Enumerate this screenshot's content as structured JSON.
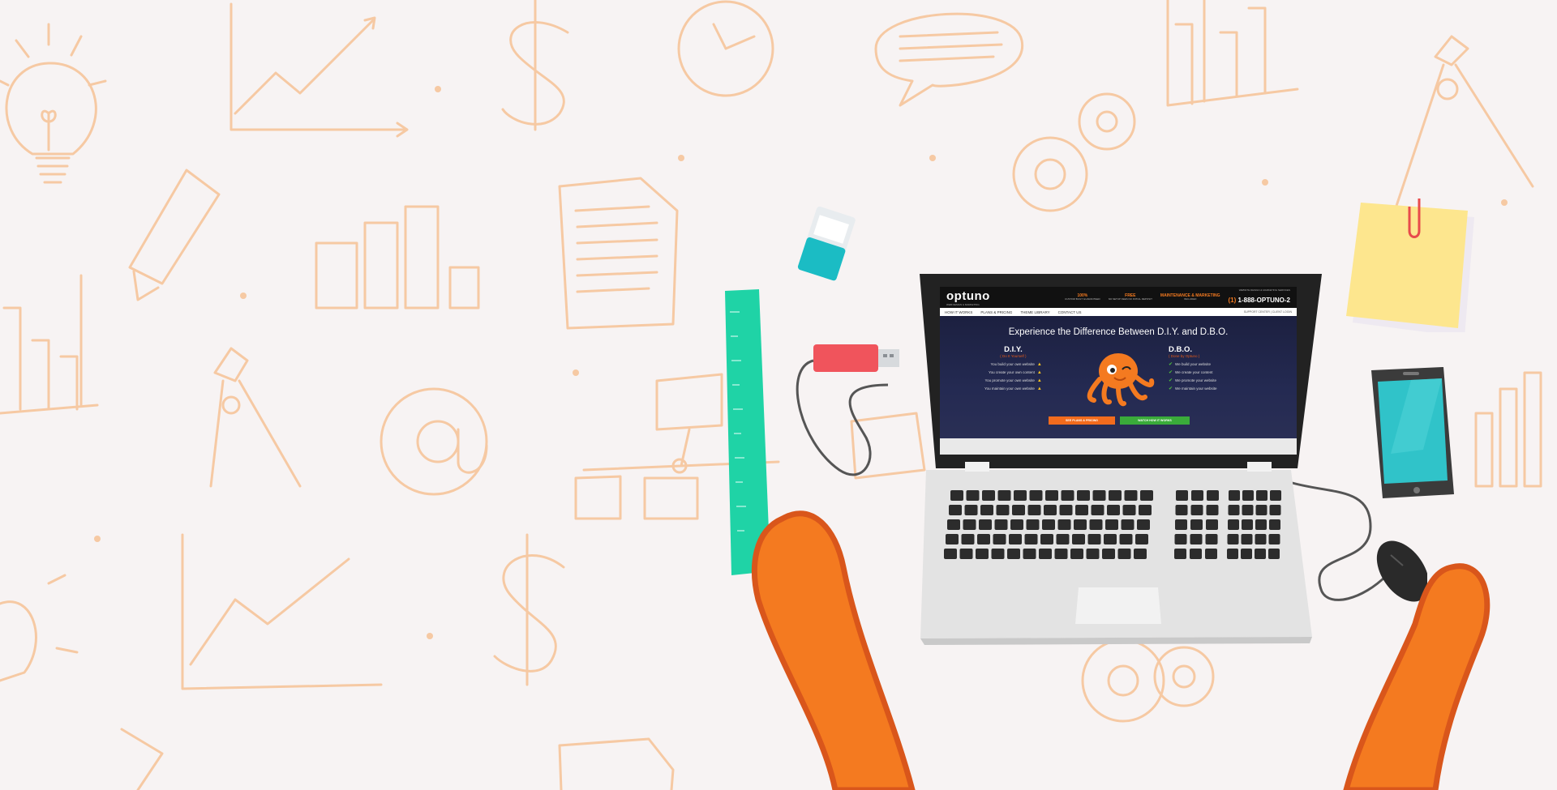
{
  "site": {
    "logo_text": "optuno",
    "logo_tagline": "WEB DESIGN & MARKETING",
    "badges": [
      {
        "title": "100%",
        "sub": "CUSTOM BUILT GUARANTEED"
      },
      {
        "title": "FREE",
        "sub": "NO SETUP FEES NO INITIAL DEPOSIT"
      },
      {
        "title": "MAINTENANCE & MARKETING",
        "sub": "INCLUDED"
      }
    ],
    "phone_caption": "WEBSITE DESIGN & MARKETING SERVICES",
    "phone_prefix": "(1)",
    "phone_number": "1-888-OPTUNO-2",
    "nav": [
      "HOW IT WORKS",
      "PLANS & PRICING",
      "THEME LIBRARY",
      "CONTACT US"
    ],
    "nav_right": "SUPPORT CENTER  |  CLIENT LOGIN",
    "hero_title": "Experience the Difference Between D.I.Y. and D.B.O.",
    "diy": {
      "heading": "D.I.Y.",
      "sub": "( Do It Yourself )",
      "items": [
        "You build your own website",
        "You create your own content",
        "You promote your own website",
        "You maintain your own website"
      ]
    },
    "dbo": {
      "heading": "D.B.O.",
      "sub": "( Done by Optuno )",
      "items": [
        "We build your website",
        "We create your content",
        "We promote your website",
        "We maintain your website"
      ]
    },
    "cta_plans": "SEE PLANS & PRICING",
    "cta_watch": "WATCH HOW IT WORKS"
  },
  "colors": {
    "background": "#f7f3f3",
    "doodle": "#f6c9a3",
    "brand_orange": "#f47a20",
    "arm_orange": "#f47a20",
    "ruler": "#1fd3a6",
    "usb": "#f0545c",
    "sticky_note": "#fde68e",
    "phone_screen": "#30c3c9"
  },
  "icons": [
    "lightbulb-icon",
    "chart-icon",
    "dollar-icon",
    "clock-icon",
    "speech-bubble-icon",
    "bar-chart-icon",
    "compass-icon",
    "gear-icon",
    "at-sign-icon",
    "document-icon",
    "flowchart-icon",
    "highlighter-icon"
  ]
}
